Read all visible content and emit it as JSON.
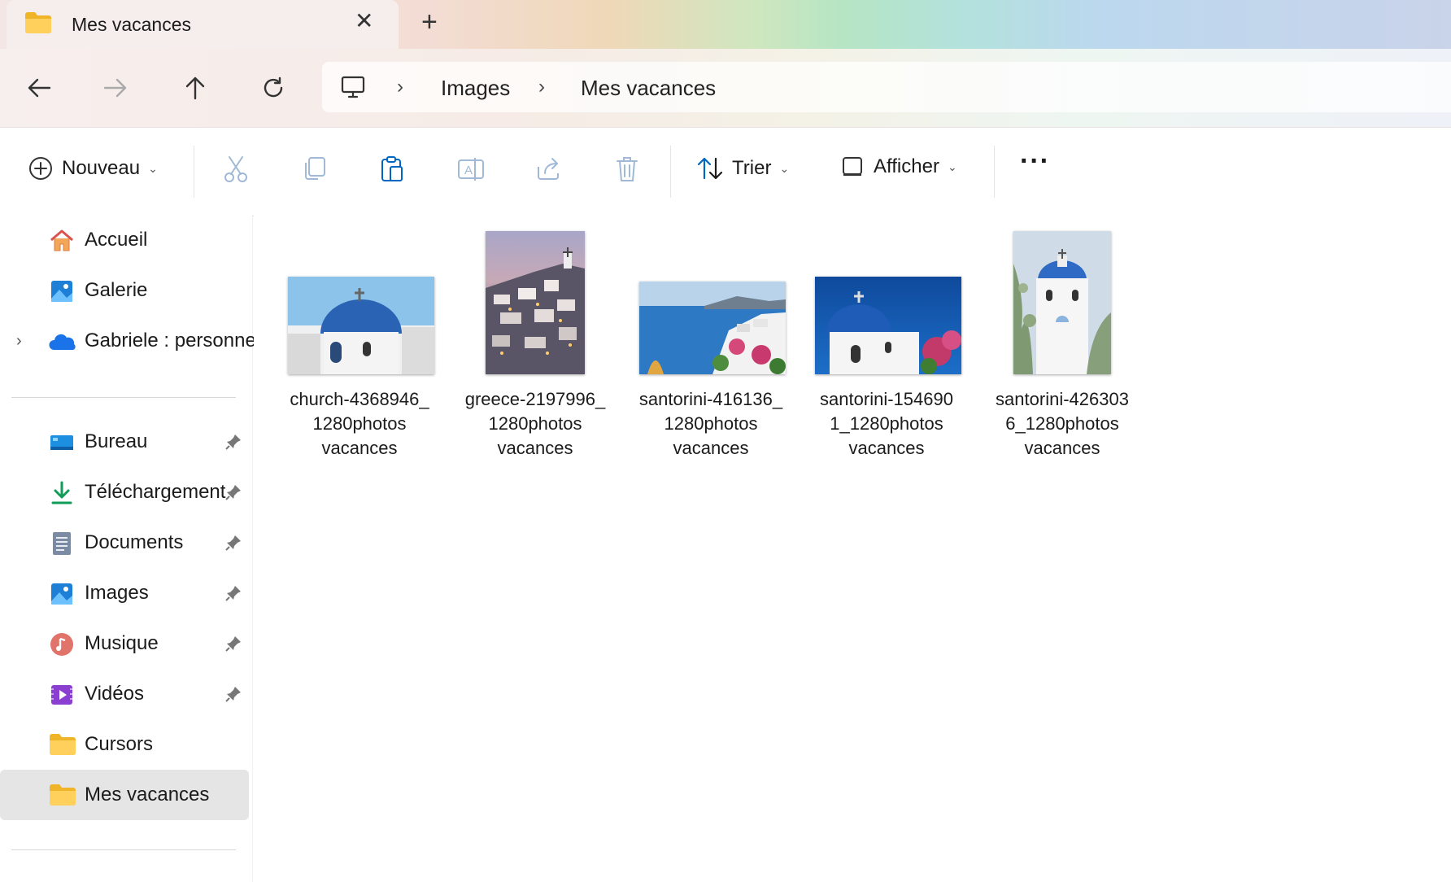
{
  "tab": {
    "title": "Mes vacances",
    "close_glyph": "✕",
    "new_tab_glyph": "+"
  },
  "nav": {
    "back_icon": "arrow-left-icon",
    "forward_icon": "arrow-right-icon",
    "up_icon": "arrow-up-icon",
    "refresh_icon": "refresh-icon"
  },
  "breadcrumb": {
    "items": [
      "Images",
      "Mes vacances"
    ],
    "separator": "›"
  },
  "toolbar": {
    "new_label": "Nouveau",
    "sort_label": "Trier",
    "view_label": "Afficher",
    "more_label": "···"
  },
  "sidebar": {
    "top_items": [
      {
        "label": "Accueil",
        "icon": "home-icon"
      },
      {
        "label": "Galerie",
        "icon": "gallery-icon"
      },
      {
        "label": "Gabriele : personne",
        "icon": "onedrive-icon"
      }
    ],
    "pinned_items": [
      {
        "label": "Bureau",
        "icon": "desktop-icon",
        "pinned": true
      },
      {
        "label": "Téléchargement",
        "icon": "download-icon",
        "pinned": true
      },
      {
        "label": "Documents",
        "icon": "documents-icon",
        "pinned": true
      },
      {
        "label": "Images",
        "icon": "images-icon",
        "pinned": true
      },
      {
        "label": "Musique",
        "icon": "music-icon",
        "pinned": true
      },
      {
        "label": "Vidéos",
        "icon": "videos-icon",
        "pinned": true
      },
      {
        "label": "Cursors",
        "icon": "folder-icon",
        "pinned": false
      },
      {
        "label": "Mes vacances",
        "icon": "folder-icon",
        "pinned": false,
        "selected": true
      }
    ]
  },
  "files": [
    {
      "name_lines": [
        "church-4368946_",
        "1280photos",
        "vacances"
      ]
    },
    {
      "name_lines": [
        "greece-2197996_",
        "1280photos",
        "vacances"
      ]
    },
    {
      "name_lines": [
        "santorini-416136_",
        "1280photos",
        "vacances"
      ]
    },
    {
      "name_lines": [
        "santorini-154690",
        "1_1280photos",
        "vacances"
      ]
    },
    {
      "name_lines": [
        "santorini-426303",
        "6_1280photos",
        "vacances"
      ]
    }
  ],
  "colors": {
    "selected_bg": "#e5e5e5",
    "folder_yellow": "#f4c542",
    "accent_blue": "#0067c0"
  }
}
